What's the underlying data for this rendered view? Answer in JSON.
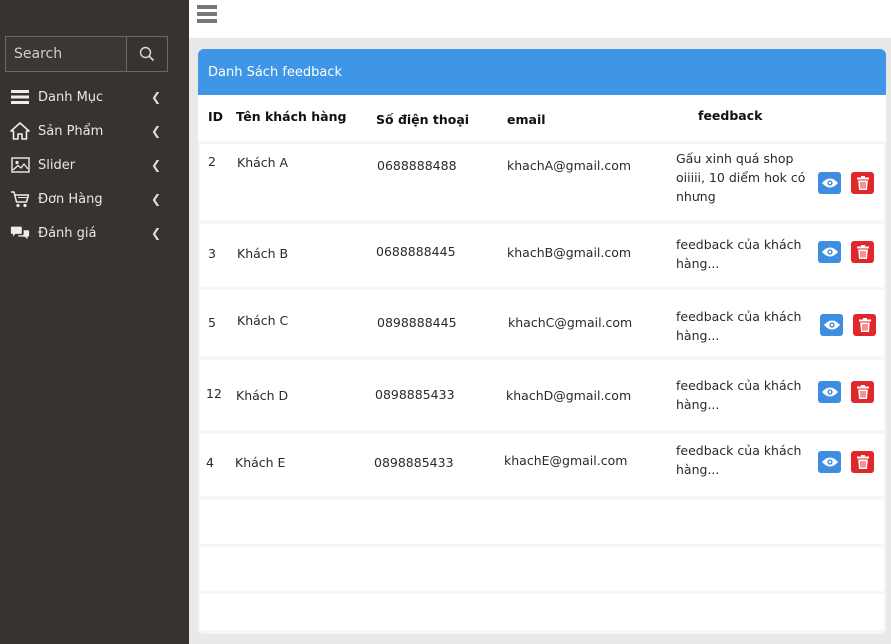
{
  "sidebar": {
    "search_placeholder": "Search",
    "items": [
      {
        "label": "Danh Mục",
        "icon": "list-icon"
      },
      {
        "label": "Sản Phẩm",
        "icon": "home-icon"
      },
      {
        "label": "Slider",
        "icon": "image-icon"
      },
      {
        "label": "Đơn Hàng",
        "icon": "cart-icon"
      },
      {
        "label": "Đánh giá",
        "icon": "comments-icon"
      }
    ]
  },
  "panel": {
    "title": "Danh Sách feedback",
    "columns": {
      "id": "ID",
      "name": "Tên khách hàng",
      "phone": "Số điện thoại",
      "email": "email",
      "feedback": "feedback"
    },
    "rows": [
      {
        "id": "2",
        "name": "Khách A",
        "phone": "0688888488",
        "email": "khachA@gmail.com",
        "feedback": "Gấu xinh quá shop oiiiii, 10 diểm hok có nhưng"
      },
      {
        "id": "3",
        "name": "Khách B",
        "phone": "0688888445",
        "email": "khachB@gmail.com",
        "feedback": "feedback của khách hàng..."
      },
      {
        "id": "5",
        "name": "Khách C",
        "phone": "0898888445",
        "email": "khachC@gmail.com",
        "feedback": "feedback của khách hàng..."
      },
      {
        "id": "12",
        "name": "Khách D",
        "phone": "0898885433",
        "email": "khachD@gmail.com",
        "feedback": "feedback của khách hàng..."
      },
      {
        "id": "4",
        "name": "Khách E",
        "phone": "0898885433",
        "email": "khachE@gmail.com",
        "feedback": "feedback của khách hàng..."
      }
    ]
  },
  "colors": {
    "sidebar": "#363331",
    "header": "#3f96e6",
    "view_button": "#3d8ee0",
    "delete_button": "#e0282c"
  }
}
